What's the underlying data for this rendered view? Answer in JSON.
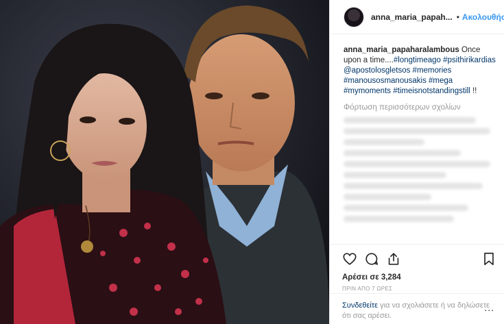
{
  "header": {
    "username": "anna_maria_papah...",
    "separator": "•",
    "follow_label": "Ακολουθήστε"
  },
  "caption": {
    "user": "anna_maria_papaharalambous",
    "text1": " Once upon a time....",
    "tag1": "#longtimeago",
    "tag2": "#psithirikardias",
    "mention": "@apostolosgletsos",
    "tag3": "#memories",
    "tag4": "#manousosmanousakis",
    "tag5": "#mega",
    "tag6": "#mymoments",
    "tag7": "#timeisnotstandingstill",
    "end": " !!"
  },
  "comments": {
    "load_more": "Φόρτωση περισσότερων σχολίων"
  },
  "actions": {
    "icons": [
      "heart-icon",
      "comment-icon",
      "share-icon",
      "bookmark-icon"
    ],
    "likes": "Αρέσει σε 3,284",
    "time": "ΠΡΙΝ ΑΠΟ 7 ΩΡΕΣ"
  },
  "login": {
    "link": "Συνδεθείτε",
    "text": " για να σχολιάσετε ή να δηλώσετε ότι σας αρέσει.",
    "more": "..."
  },
  "colors": {
    "link": "#3897f0",
    "hashtag": "#003569",
    "muted": "#999999"
  }
}
